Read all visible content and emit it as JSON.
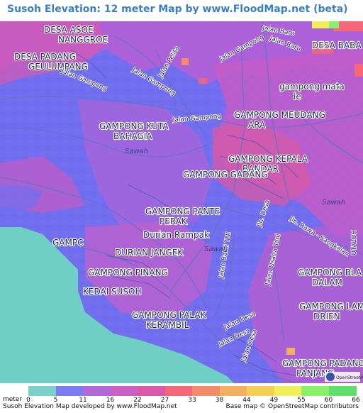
{
  "title": "Susoh Elevation: 12 meter Map by www.FloodMap.net (beta)",
  "map": {
    "places": [
      "DESA ASOE NANGGROE",
      "DESA PADANG GEULUMPANG",
      "DESA BABA",
      "gampong mata ie",
      "GAMPONG MEUDANG ARA",
      "GAMPONG KUTA BAHAGIA",
      "GAMPONG KEPALA BANDAR",
      "GAMPONG GADANG",
      "GAMPONG PANTE PERAK",
      "Durian Rampak",
      "DURIAN JANGEK",
      "GAMPONG PINANG",
      "KEDAI SUSOH",
      "GAMPONG PALAK KERAMBIL",
      "GAMPONG BLA DALAM",
      "GAMPONG LAMP DRIEN",
      "GAMPONG PADANG PANJANG",
      "GAMPC",
      "UTALOH"
    ],
    "streets": [
      "Jalan Gampong",
      "Jalan Pelita",
      "Jalan Baru",
      "Jln. Desa",
      "Jln. Rawa - Sangkalan",
      "Jalan Bakti TNI",
      "Jalan Usaha Tani",
      "Jalan Desa"
    ],
    "areas": [
      "Sawah",
      "Sawah",
      "Sawah"
    ]
  },
  "legend": {
    "unit": "meter",
    "ticks": [
      "0",
      "5",
      "11",
      "16",
      "22",
      "27",
      "33",
      "38",
      "44",
      "49",
      "55",
      "60",
      "66"
    ],
    "colors": [
      "#7ad0c5",
      "#7b7cf0",
      "#b06ad8",
      "#cc5fc4",
      "#d85aa8",
      "#f46878",
      "#f48c6c",
      "#f4b060",
      "#f6cf58",
      "#f2ef5c",
      "#8af06a",
      "#5fe06a"
    ]
  },
  "footer": {
    "left": "Susoh Elevation Map developed by www.FloodMap.net",
    "right": "Base map © OpenStreetMap contributors"
  },
  "logo_text": "OpenStreetMap"
}
